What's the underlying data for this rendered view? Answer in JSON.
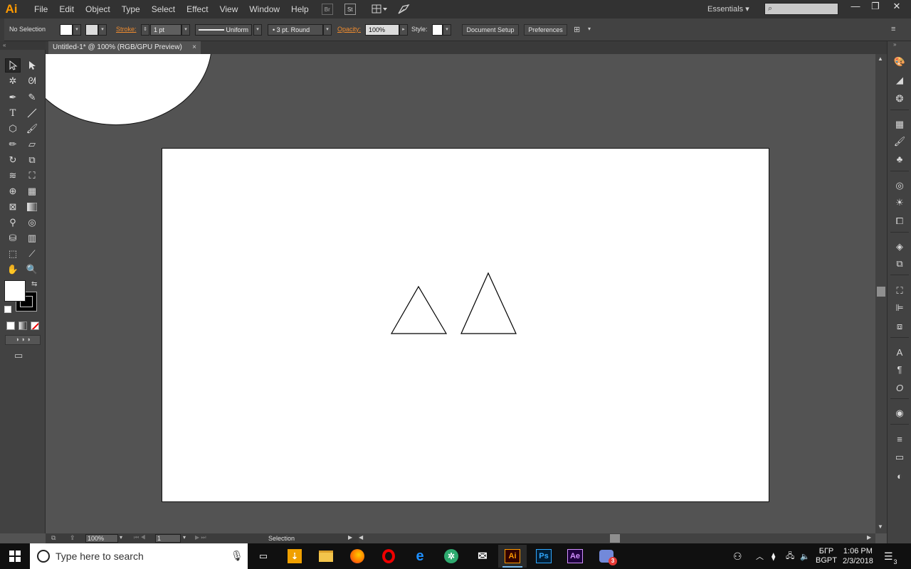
{
  "app": {
    "logo": "Ai"
  },
  "menu": [
    "File",
    "Edit",
    "Object",
    "Type",
    "Select",
    "Effect",
    "View",
    "Window",
    "Help"
  ],
  "menubar_icons": {
    "bridge": "Br",
    "stock": "St"
  },
  "workspace": "Essentials",
  "control": {
    "selection": "No Selection",
    "stroke_label": "Stroke:",
    "stroke_value": "1 pt",
    "profile": "Uniform",
    "brush": "3 pt. Round",
    "opacity_label": "Opacity:",
    "opacity_value": "100%",
    "style_label": "Style:",
    "doc_setup": "Document Setup",
    "preferences": "Preferences"
  },
  "document": {
    "tab_title": "Untitled-1* @ 100% (RGB/GPU Preview)",
    "close": "×"
  },
  "status": {
    "zoom": "100%",
    "artboard": "1",
    "tool": "Selection"
  },
  "taskbar": {
    "search_placeholder": "Type here to search",
    "apps": [
      {
        "name": "illustrator",
        "label": "Ai",
        "color": "#ff9a00",
        "bg": "#330000",
        "running": true
      },
      {
        "name": "photoshop",
        "label": "Ps",
        "color": "#31a8ff",
        "bg": "#001e36",
        "running": false
      },
      {
        "name": "after-effects",
        "label": "Ae",
        "color": "#d291ff",
        "bg": "#1f0040",
        "running": false
      }
    ],
    "lang": "БГР",
    "lang2": "BGPT",
    "time": "1:06 PM",
    "date": "2/3/2018",
    "notif_count": "3",
    "discord_badge": "3"
  },
  "colors": {
    "accent": "#ff9a00",
    "panel": "#424242",
    "canvas": "#535353",
    "orange_label": "#ef8c2f"
  }
}
